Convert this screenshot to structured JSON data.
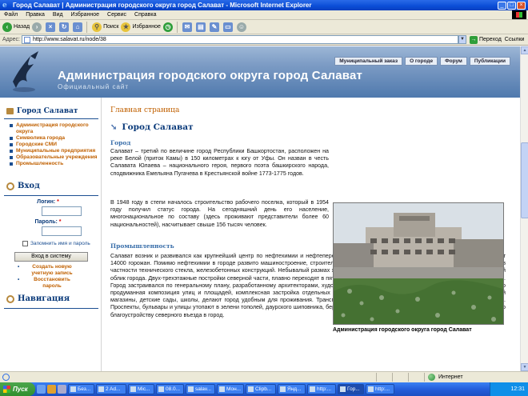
{
  "window": {
    "title": "Город Салават | Администрация городского округа город Салават - Microsoft Internet Explorer"
  },
  "menu": [
    "Файл",
    "Правка",
    "Вид",
    "Избранное",
    "Сервис",
    "Справка"
  ],
  "toolbar": {
    "back": "Назад",
    "search": "Поиск",
    "favorites": "Избранное"
  },
  "address": {
    "label": "Адрес:",
    "url": "http://www.salavat.ru/node/38",
    "go": "Переход",
    "links": "Ссылки"
  },
  "site": {
    "title": "Администрация городского округа город Салават",
    "subtitle": "Официальный сайт",
    "nav": [
      "Муниципальный заказ",
      "О городе",
      "Форум",
      "Публикации"
    ]
  },
  "sidebar": {
    "heading": "Город Салават",
    "items": [
      "Администрация городского округа",
      "Символика города",
      "Городские СМИ",
      "Муниципальные предприятия",
      "Образовательные учреждения",
      "Промышленность"
    ],
    "login": {
      "heading": "Вход",
      "login_label": "Логин:",
      "password_label": "Пароль:",
      "required": "*",
      "remember": "Запомнить имя и пароль",
      "button": "Вход в систему",
      "links": [
        "Создать новую учетную запись",
        "Восстановить пароль"
      ]
    },
    "nav_heading": "Навигация"
  },
  "main": {
    "breadcrumb": "Главная страница",
    "heading": "Город Салават",
    "section1": "Город",
    "para1": "Салават – третий по величине город Республики Башкортостан, расположен на реке Белой (приток Камы) в 150 километрах к югу от Уфы. Он назван в честь Салавата Юлаева – национального героя, первого поэта башкирского народа, сподвижника Емельяна Пугачева в Крестьянской войне 1773-1775 годов.",
    "para2": "В 1948 году в степи началось строительство рабочего поселка, который в 1954 году получил статус города. На сегодняшний день его население, многонациональное по составу (здесь проживают представители более 60 национальностей), насчитывает свыше 156 тысяч человек.",
    "section2": "Промышленность",
    "para3": "Салават возник и развивался как крупнейший центр по нефтехимии и нефтепереработке. Сегодня на градообразующем предприятии работают 14000 горожан. Помимо нефтехимии в городе развито машиностроение, строительная индустрия, промышленность строительных материалов, в частности технического стекла, железобетонных конструкций. Небывалый размах жилищного строительства в 70-80 годы определил современный облик города. Двух-трехэтажные постройки северной части, плавно переходят в пятиэтажный административный центр и высотную торговую часть. Город застраивался по генеральному плану, разработанному архитекторами, художниками и инженерами ЛенНИИП градостроительства. Хорошо продуманная композиция улиц и площадей, комплексная застройка отдельных микрорайонов, где одновременно с жильем вводятся в строй магазины, детские сады, школы, делают город удобным для проживания. Транспортные магистрали соединяют жилую и промышленную зоны. Проспекты, бульвары и улицы утопают в зелени тополей, даурского шиповника, берез, ряби, липы. В настоящее время ведется активная работа по благоустройству северного въезда в город.",
    "caption": "Администрация городского округа город Салават"
  },
  "status": {
    "zone": "Интернет"
  },
  "taskbar": {
    "start": "Пуск",
    "tasks": [
      "Без...",
      "2 Ad...",
      "Mic...",
      "08.0...",
      "salav...",
      "Мон...",
      "Clipb...",
      "Янд...",
      "http:...",
      "Гор...",
      "http:..."
    ],
    "clock": "12:31"
  }
}
